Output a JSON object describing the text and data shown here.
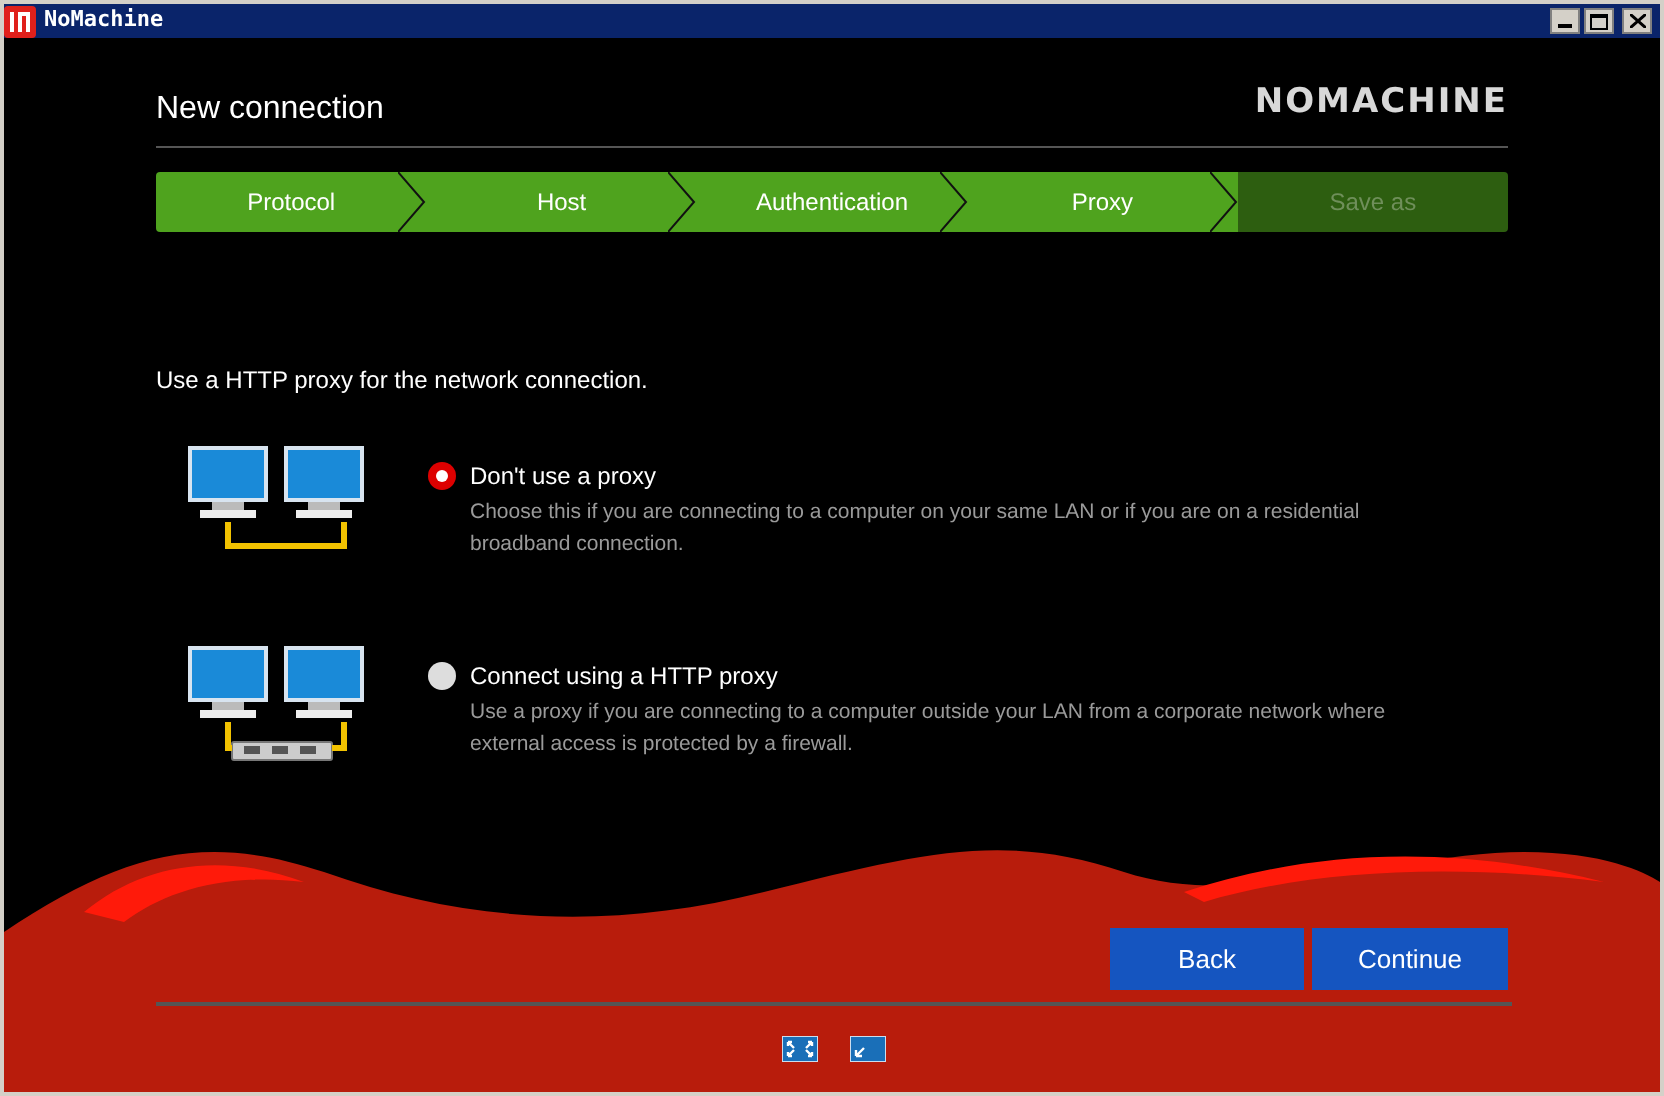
{
  "window": {
    "title": "NoMachine"
  },
  "header": {
    "title": "New connection",
    "logo": "NOMACHINE"
  },
  "steps": [
    {
      "label": "Protocol",
      "reached": true
    },
    {
      "label": "Host",
      "reached": true
    },
    {
      "label": "Authentication",
      "reached": true
    },
    {
      "label": "Proxy",
      "reached": true
    },
    {
      "label": "Save as",
      "reached": false
    }
  ],
  "prompt": "Use a HTTP proxy for the network connection.",
  "options": [
    {
      "kind": "direct",
      "label": "Don't use a proxy",
      "description": "Choose this if you are connecting to a computer on your same LAN or if you are on a residential broadband connection.",
      "selected": true
    },
    {
      "kind": "proxy",
      "label": "Connect using a HTTP proxy",
      "description": "Use a proxy if you are connecting to a computer outside your LAN from a corporate network where external access is protected by a firewall.",
      "selected": false
    }
  ],
  "buttons": [
    "Back",
    "Continue"
  ]
}
